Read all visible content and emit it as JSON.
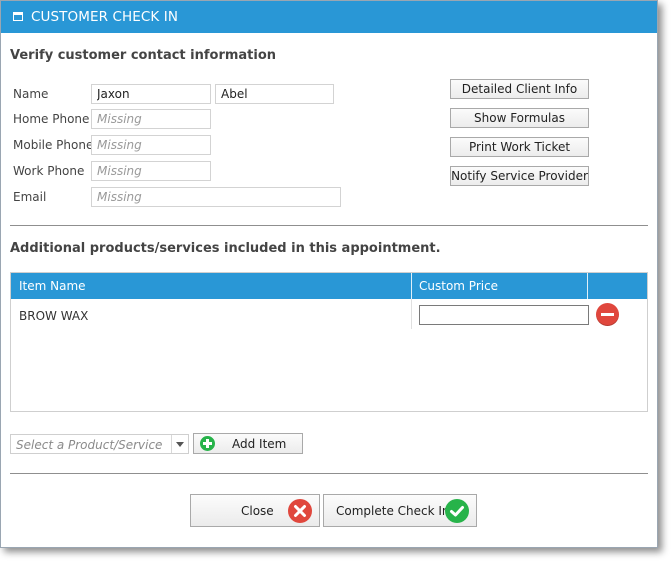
{
  "window": {
    "title": "CUSTOMER CHECK IN"
  },
  "contact": {
    "heading": "Verify customer contact information",
    "fields": {
      "name_label": "Name",
      "first_name": "Jaxon",
      "last_name": "Abel",
      "home_phone_label": "Home Phone",
      "home_phone_placeholder": "Missing",
      "mobile_phone_label": "Mobile Phone",
      "mobile_phone_placeholder": "Missing",
      "work_phone_label": "Work Phone",
      "work_phone_placeholder": "Missing",
      "email_label": "Email",
      "email_placeholder": "Missing"
    },
    "buttons": {
      "detailed_client_info": "Detailed Client Info",
      "show_formulas": "Show Formulas",
      "print_work_ticket": "Print Work Ticket",
      "notify_service_provider": "Notify Service Provider"
    }
  },
  "products": {
    "heading": "Additional products/services included in this appointment.",
    "columns": {
      "item_name": "Item Name",
      "custom_price": "Custom Price"
    },
    "rows": [
      {
        "item_name": "BROW WAX",
        "custom_price": ""
      }
    ],
    "select_placeholder": "Select a Product/Service",
    "add_item_label": "Add Item"
  },
  "footer": {
    "close_label": "Close",
    "complete_label": "Complete Check In"
  },
  "colors": {
    "accent": "#2997d6",
    "danger": "#e0473d",
    "success": "#27b34a"
  },
  "icons": [
    "window-icon",
    "remove-icon",
    "plus-circle-icon",
    "close-icon",
    "check-icon",
    "dropdown-arrow-icon"
  ]
}
